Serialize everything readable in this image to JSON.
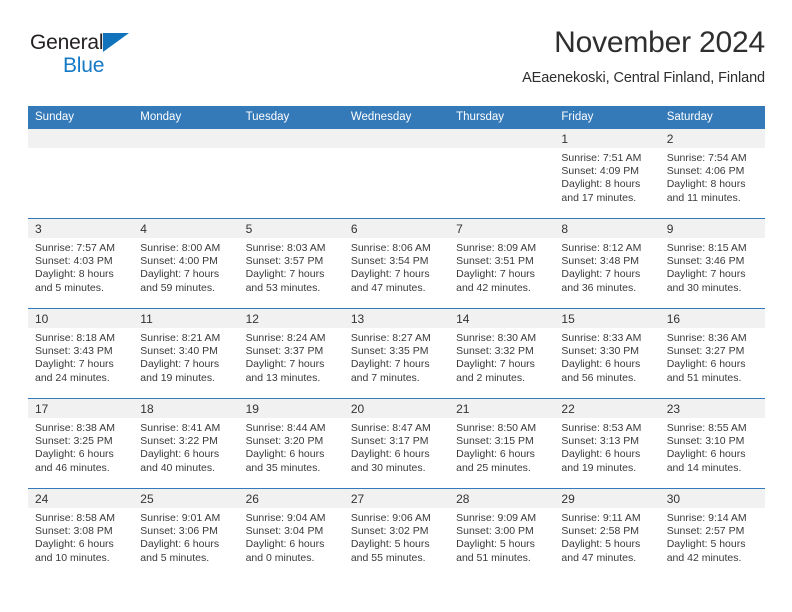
{
  "brand": {
    "name_part1": "General",
    "name_part2": "Blue",
    "triangle_color": "#1073bb",
    "text_color_1": "#231f20",
    "text_color_2": "#1579c6"
  },
  "header": {
    "title": "November 2024",
    "subtitle": "AEaenekoski, Central Finland, Finland"
  },
  "theme": {
    "header_blue": "#3479b8",
    "daynum_band": "#f1f1f1",
    "text": "#333333"
  },
  "calendar": {
    "weekday_headers": [
      "Sunday",
      "Monday",
      "Tuesday",
      "Wednesday",
      "Thursday",
      "Friday",
      "Saturday"
    ],
    "weeks": [
      [
        {
          "day": "",
          "sunrise": "",
          "sunset": "",
          "daylight_line1": "",
          "daylight_line2": ""
        },
        {
          "day": "",
          "sunrise": "",
          "sunset": "",
          "daylight_line1": "",
          "daylight_line2": ""
        },
        {
          "day": "",
          "sunrise": "",
          "sunset": "",
          "daylight_line1": "",
          "daylight_line2": ""
        },
        {
          "day": "",
          "sunrise": "",
          "sunset": "",
          "daylight_line1": "",
          "daylight_line2": ""
        },
        {
          "day": "",
          "sunrise": "",
          "sunset": "",
          "daylight_line1": "",
          "daylight_line2": ""
        },
        {
          "day": "1",
          "sunrise": "Sunrise: 7:51 AM",
          "sunset": "Sunset: 4:09 PM",
          "daylight_line1": "Daylight: 8 hours",
          "daylight_line2": "and 17 minutes."
        },
        {
          "day": "2",
          "sunrise": "Sunrise: 7:54 AM",
          "sunset": "Sunset: 4:06 PM",
          "daylight_line1": "Daylight: 8 hours",
          "daylight_line2": "and 11 minutes."
        }
      ],
      [
        {
          "day": "3",
          "sunrise": "Sunrise: 7:57 AM",
          "sunset": "Sunset: 4:03 PM",
          "daylight_line1": "Daylight: 8 hours",
          "daylight_line2": "and 5 minutes."
        },
        {
          "day": "4",
          "sunrise": "Sunrise: 8:00 AM",
          "sunset": "Sunset: 4:00 PM",
          "daylight_line1": "Daylight: 7 hours",
          "daylight_line2": "and 59 minutes."
        },
        {
          "day": "5",
          "sunrise": "Sunrise: 8:03 AM",
          "sunset": "Sunset: 3:57 PM",
          "daylight_line1": "Daylight: 7 hours",
          "daylight_line2": "and 53 minutes."
        },
        {
          "day": "6",
          "sunrise": "Sunrise: 8:06 AM",
          "sunset": "Sunset: 3:54 PM",
          "daylight_line1": "Daylight: 7 hours",
          "daylight_line2": "and 47 minutes."
        },
        {
          "day": "7",
          "sunrise": "Sunrise: 8:09 AM",
          "sunset": "Sunset: 3:51 PM",
          "daylight_line1": "Daylight: 7 hours",
          "daylight_line2": "and 42 minutes."
        },
        {
          "day": "8",
          "sunrise": "Sunrise: 8:12 AM",
          "sunset": "Sunset: 3:48 PM",
          "daylight_line1": "Daylight: 7 hours",
          "daylight_line2": "and 36 minutes."
        },
        {
          "day": "9",
          "sunrise": "Sunrise: 8:15 AM",
          "sunset": "Sunset: 3:46 PM",
          "daylight_line1": "Daylight: 7 hours",
          "daylight_line2": "and 30 minutes."
        }
      ],
      [
        {
          "day": "10",
          "sunrise": "Sunrise: 8:18 AM",
          "sunset": "Sunset: 3:43 PM",
          "daylight_line1": "Daylight: 7 hours",
          "daylight_line2": "and 24 minutes."
        },
        {
          "day": "11",
          "sunrise": "Sunrise: 8:21 AM",
          "sunset": "Sunset: 3:40 PM",
          "daylight_line1": "Daylight: 7 hours",
          "daylight_line2": "and 19 minutes."
        },
        {
          "day": "12",
          "sunrise": "Sunrise: 8:24 AM",
          "sunset": "Sunset: 3:37 PM",
          "daylight_line1": "Daylight: 7 hours",
          "daylight_line2": "and 13 minutes."
        },
        {
          "day": "13",
          "sunrise": "Sunrise: 8:27 AM",
          "sunset": "Sunset: 3:35 PM",
          "daylight_line1": "Daylight: 7 hours",
          "daylight_line2": "and 7 minutes."
        },
        {
          "day": "14",
          "sunrise": "Sunrise: 8:30 AM",
          "sunset": "Sunset: 3:32 PM",
          "daylight_line1": "Daylight: 7 hours",
          "daylight_line2": "and 2 minutes."
        },
        {
          "day": "15",
          "sunrise": "Sunrise: 8:33 AM",
          "sunset": "Sunset: 3:30 PM",
          "daylight_line1": "Daylight: 6 hours",
          "daylight_line2": "and 56 minutes."
        },
        {
          "day": "16",
          "sunrise": "Sunrise: 8:36 AM",
          "sunset": "Sunset: 3:27 PM",
          "daylight_line1": "Daylight: 6 hours",
          "daylight_line2": "and 51 minutes."
        }
      ],
      [
        {
          "day": "17",
          "sunrise": "Sunrise: 8:38 AM",
          "sunset": "Sunset: 3:25 PM",
          "daylight_line1": "Daylight: 6 hours",
          "daylight_line2": "and 46 minutes."
        },
        {
          "day": "18",
          "sunrise": "Sunrise: 8:41 AM",
          "sunset": "Sunset: 3:22 PM",
          "daylight_line1": "Daylight: 6 hours",
          "daylight_line2": "and 40 minutes."
        },
        {
          "day": "19",
          "sunrise": "Sunrise: 8:44 AM",
          "sunset": "Sunset: 3:20 PM",
          "daylight_line1": "Daylight: 6 hours",
          "daylight_line2": "and 35 minutes."
        },
        {
          "day": "20",
          "sunrise": "Sunrise: 8:47 AM",
          "sunset": "Sunset: 3:17 PM",
          "daylight_line1": "Daylight: 6 hours",
          "daylight_line2": "and 30 minutes."
        },
        {
          "day": "21",
          "sunrise": "Sunrise: 8:50 AM",
          "sunset": "Sunset: 3:15 PM",
          "daylight_line1": "Daylight: 6 hours",
          "daylight_line2": "and 25 minutes."
        },
        {
          "day": "22",
          "sunrise": "Sunrise: 8:53 AM",
          "sunset": "Sunset: 3:13 PM",
          "daylight_line1": "Daylight: 6 hours",
          "daylight_line2": "and 19 minutes."
        },
        {
          "day": "23",
          "sunrise": "Sunrise: 8:55 AM",
          "sunset": "Sunset: 3:10 PM",
          "daylight_line1": "Daylight: 6 hours",
          "daylight_line2": "and 14 minutes."
        }
      ],
      [
        {
          "day": "24",
          "sunrise": "Sunrise: 8:58 AM",
          "sunset": "Sunset: 3:08 PM",
          "daylight_line1": "Daylight: 6 hours",
          "daylight_line2": "and 10 minutes."
        },
        {
          "day": "25",
          "sunrise": "Sunrise: 9:01 AM",
          "sunset": "Sunset: 3:06 PM",
          "daylight_line1": "Daylight: 6 hours",
          "daylight_line2": "and 5 minutes."
        },
        {
          "day": "26",
          "sunrise": "Sunrise: 9:04 AM",
          "sunset": "Sunset: 3:04 PM",
          "daylight_line1": "Daylight: 6 hours",
          "daylight_line2": "and 0 minutes."
        },
        {
          "day": "27",
          "sunrise": "Sunrise: 9:06 AM",
          "sunset": "Sunset: 3:02 PM",
          "daylight_line1": "Daylight: 5 hours",
          "daylight_line2": "and 55 minutes."
        },
        {
          "day": "28",
          "sunrise": "Sunrise: 9:09 AM",
          "sunset": "Sunset: 3:00 PM",
          "daylight_line1": "Daylight: 5 hours",
          "daylight_line2": "and 51 minutes."
        },
        {
          "day": "29",
          "sunrise": "Sunrise: 9:11 AM",
          "sunset": "Sunset: 2:58 PM",
          "daylight_line1": "Daylight: 5 hours",
          "daylight_line2": "and 47 minutes."
        },
        {
          "day": "30",
          "sunrise": "Sunrise: 9:14 AM",
          "sunset": "Sunset: 2:57 PM",
          "daylight_line1": "Daylight: 5 hours",
          "daylight_line2": "and 42 minutes."
        }
      ]
    ]
  }
}
